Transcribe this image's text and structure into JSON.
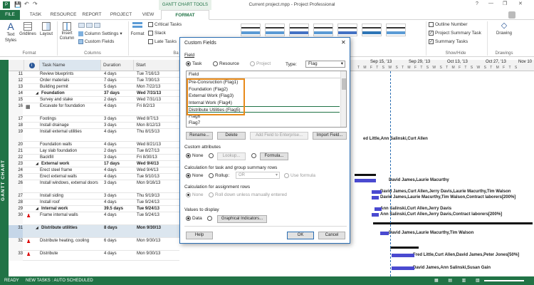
{
  "app": {
    "title": "Current project.mpp - Project Professional",
    "tool_tab": "GANTT CHART TOOLS",
    "user": "?",
    "window_controls": [
      "?",
      "—",
      "❐",
      "✕"
    ]
  },
  "tabs": [
    "FILE",
    "TASK",
    "RESOURCE",
    "REPORT",
    "PROJECT",
    "VIEW",
    "FORMAT"
  ],
  "ribbon": {
    "format": {
      "text_styles": "Text Styles",
      "gridlines": "Gridlines",
      "layout": "Layout",
      "label": "Format"
    },
    "columns": {
      "insert_column": "Insert Column",
      "column_settings": "Column Settings",
      "custom_fields": "Custom Fields",
      "label": "Columns"
    },
    "format_btn": "Format",
    "bar_styles": {
      "critical_tasks": "Critical Tasks",
      "slack": "Slack",
      "late_tasks": "Late Tasks",
      "label": "Ba"
    },
    "show_hide": {
      "outline_number": "Outline Number",
      "project_summary_task": "Project Summary Task",
      "summary_tasks": "Summary Tasks",
      "label": "Show/Hide"
    },
    "drawings": {
      "drawing": "Drawing",
      "label": "Drawings"
    }
  },
  "side_label": "GANTT CHART",
  "table": {
    "headers": [
      "Task Name",
      "Duration",
      "Start"
    ],
    "rows": [
      {
        "id": "11",
        "name": "Review blueprints",
        "dur": "4 days",
        "start": "Tue 7/16/13",
        "bold": false
      },
      {
        "id": "12",
        "name": "Order materials",
        "dur": "7 days",
        "start": "Tue 7/30/13",
        "bold": false
      },
      {
        "id": "13",
        "name": "Building permit",
        "dur": "5 days",
        "start": "Mon 7/22/13",
        "bold": false
      },
      {
        "id": "14",
        "name": "Foundation",
        "dur": "37 days",
        "start": "Wed 7/31/13",
        "bold": true
      },
      {
        "id": "15",
        "name": "Survey and stake",
        "dur": "2 days",
        "start": "Wed 7/31/13",
        "bold": false
      },
      {
        "id": "16",
        "name": "Excavate for foundation",
        "dur": "4 days",
        "start": "Fri 8/2/13",
        "bold": false
      },
      {
        "id": "17",
        "name": "Footings",
        "dur": "3 days",
        "start": "Wed 8/7/13",
        "bold": false
      },
      {
        "id": "18",
        "name": "Install drainage",
        "dur": "3 days",
        "start": "Mon 8/12/13",
        "bold": false
      },
      {
        "id": "19",
        "name": "Install external utilities",
        "dur": "4 days",
        "start": "Thu 8/15/13",
        "bold": false
      },
      {
        "id": "20",
        "name": "Foundation walls",
        "dur": "4 days",
        "start": "Wed 8/21/13",
        "bold": false
      },
      {
        "id": "21",
        "name": "Lay slab foundation",
        "dur": "2 days",
        "start": "Tue 8/27/13",
        "bold": false
      },
      {
        "id": "22",
        "name": "Backfill",
        "dur": "3 days",
        "start": "Fri 8/30/13",
        "bold": false
      },
      {
        "id": "23",
        "name": "External work",
        "dur": "17 days",
        "start": "Wed 9/4/13",
        "bold": true
      },
      {
        "id": "24",
        "name": "Erect steel frame",
        "dur": "4 days",
        "start": "Wed 9/4/13",
        "bold": false
      },
      {
        "id": "25",
        "name": "Erect external walls",
        "dur": "4 days",
        "start": "Tue 9/10/13",
        "bold": false
      },
      {
        "id": "26",
        "name": "Install windows, external doors",
        "dur": "3 days",
        "start": "Mon 9/16/13",
        "bold": false
      },
      {
        "id": "27",
        "name": "Install siding",
        "dur": "3 days",
        "start": "Thu 9/19/13",
        "bold": false
      },
      {
        "id": "28",
        "name": "Install roof",
        "dur": "4 days",
        "start": "Tue 9/24/13",
        "bold": false
      },
      {
        "id": "29",
        "name": "Internal work",
        "dur": "39.5 days",
        "start": "Tue 9/24/13",
        "bold": true
      },
      {
        "id": "30",
        "name": "Frame internal walls",
        "dur": "4 days",
        "start": "Tue 9/24/13",
        "bold": false
      },
      {
        "id": "31",
        "name": "Distribute utilities",
        "dur": "8 days",
        "start": "Mon 9/30/13",
        "bold": true
      },
      {
        "id": "32",
        "name": "Distribute heating, cooling",
        "dur": "6 days",
        "start": "Mon 9/30/13",
        "bold": false
      },
      {
        "id": "33",
        "name": "Distribute",
        "dur": "4 days",
        "start": "Mon 9/30/13",
        "bold": false
      }
    ]
  },
  "timeline": {
    "dates": [
      "Sep 15, '13",
      "Sep 29, '13",
      "Oct 13, '13",
      "Oct 27, '13",
      "Nov 10"
    ],
    "days": "T M F T S W S T M F T S W S T M F T S W S T M F T S"
  },
  "gantt_labels": [
    "ed Little,Ann Salinski,Curt Allen",
    "David James,Laurie Macurthy",
    "David James,Curt Allen,Jerry Davis,Laurie Macurthy,Tim Walson",
    "David James,Laurie Macurthy,Tim Walson,Contract laborers[200%]",
    "Ann Salinski,Curt Allen,Jerry Davis",
    "Ann Salinski,Curt Allen,Jerry Davis,Contract laborers[200%]",
    "David James,Laurie Macurthy,Tim Walson",
    "Fred Little,Curt Allen,David James,Peter Jones[50%]",
    "David James,Ann Salinski,Susan Gain"
  ],
  "dialog": {
    "title": "Custom Fields",
    "field_label": "Field",
    "task": "Task",
    "resource": "Resource",
    "project": "Project",
    "type_label": "Type:",
    "type_value": "Flag",
    "list_header": "Field",
    "fields": [
      "Pre-Consruction (Flag1)",
      "Foundation (Flag2)",
      "External Work (Flag3)",
      "Internal Work (Flag4)",
      "Distribute Utilities (Flag5)",
      "Flag6",
      "Flag7"
    ],
    "rename": "Rename...",
    "delete": "Delete",
    "add_field": "Add Field to Enterprise...",
    "import_field": "Import Field...",
    "custom_attributes": "Custom attributes",
    "none": "None",
    "lookup": "Lookup...",
    "formula": "Formula...",
    "calc_summary": "Calculation for task and group summary rows",
    "rollup": "Rollup:",
    "rollup_value": "OR",
    "use_formula": "Use formula",
    "calc_assignment": "Calculation for assignment rows",
    "roll_down": "Roll down unless manually entered",
    "values_to_display": "Values to display",
    "data": "Data",
    "graphical": "Graphical Indicators...",
    "help": "Help",
    "ok": "OK",
    "cancel": "Cancel"
  },
  "status": {
    "mode": "READY",
    "new_tasks": "NEW TASKS : AUTO SCHEDULED"
  }
}
